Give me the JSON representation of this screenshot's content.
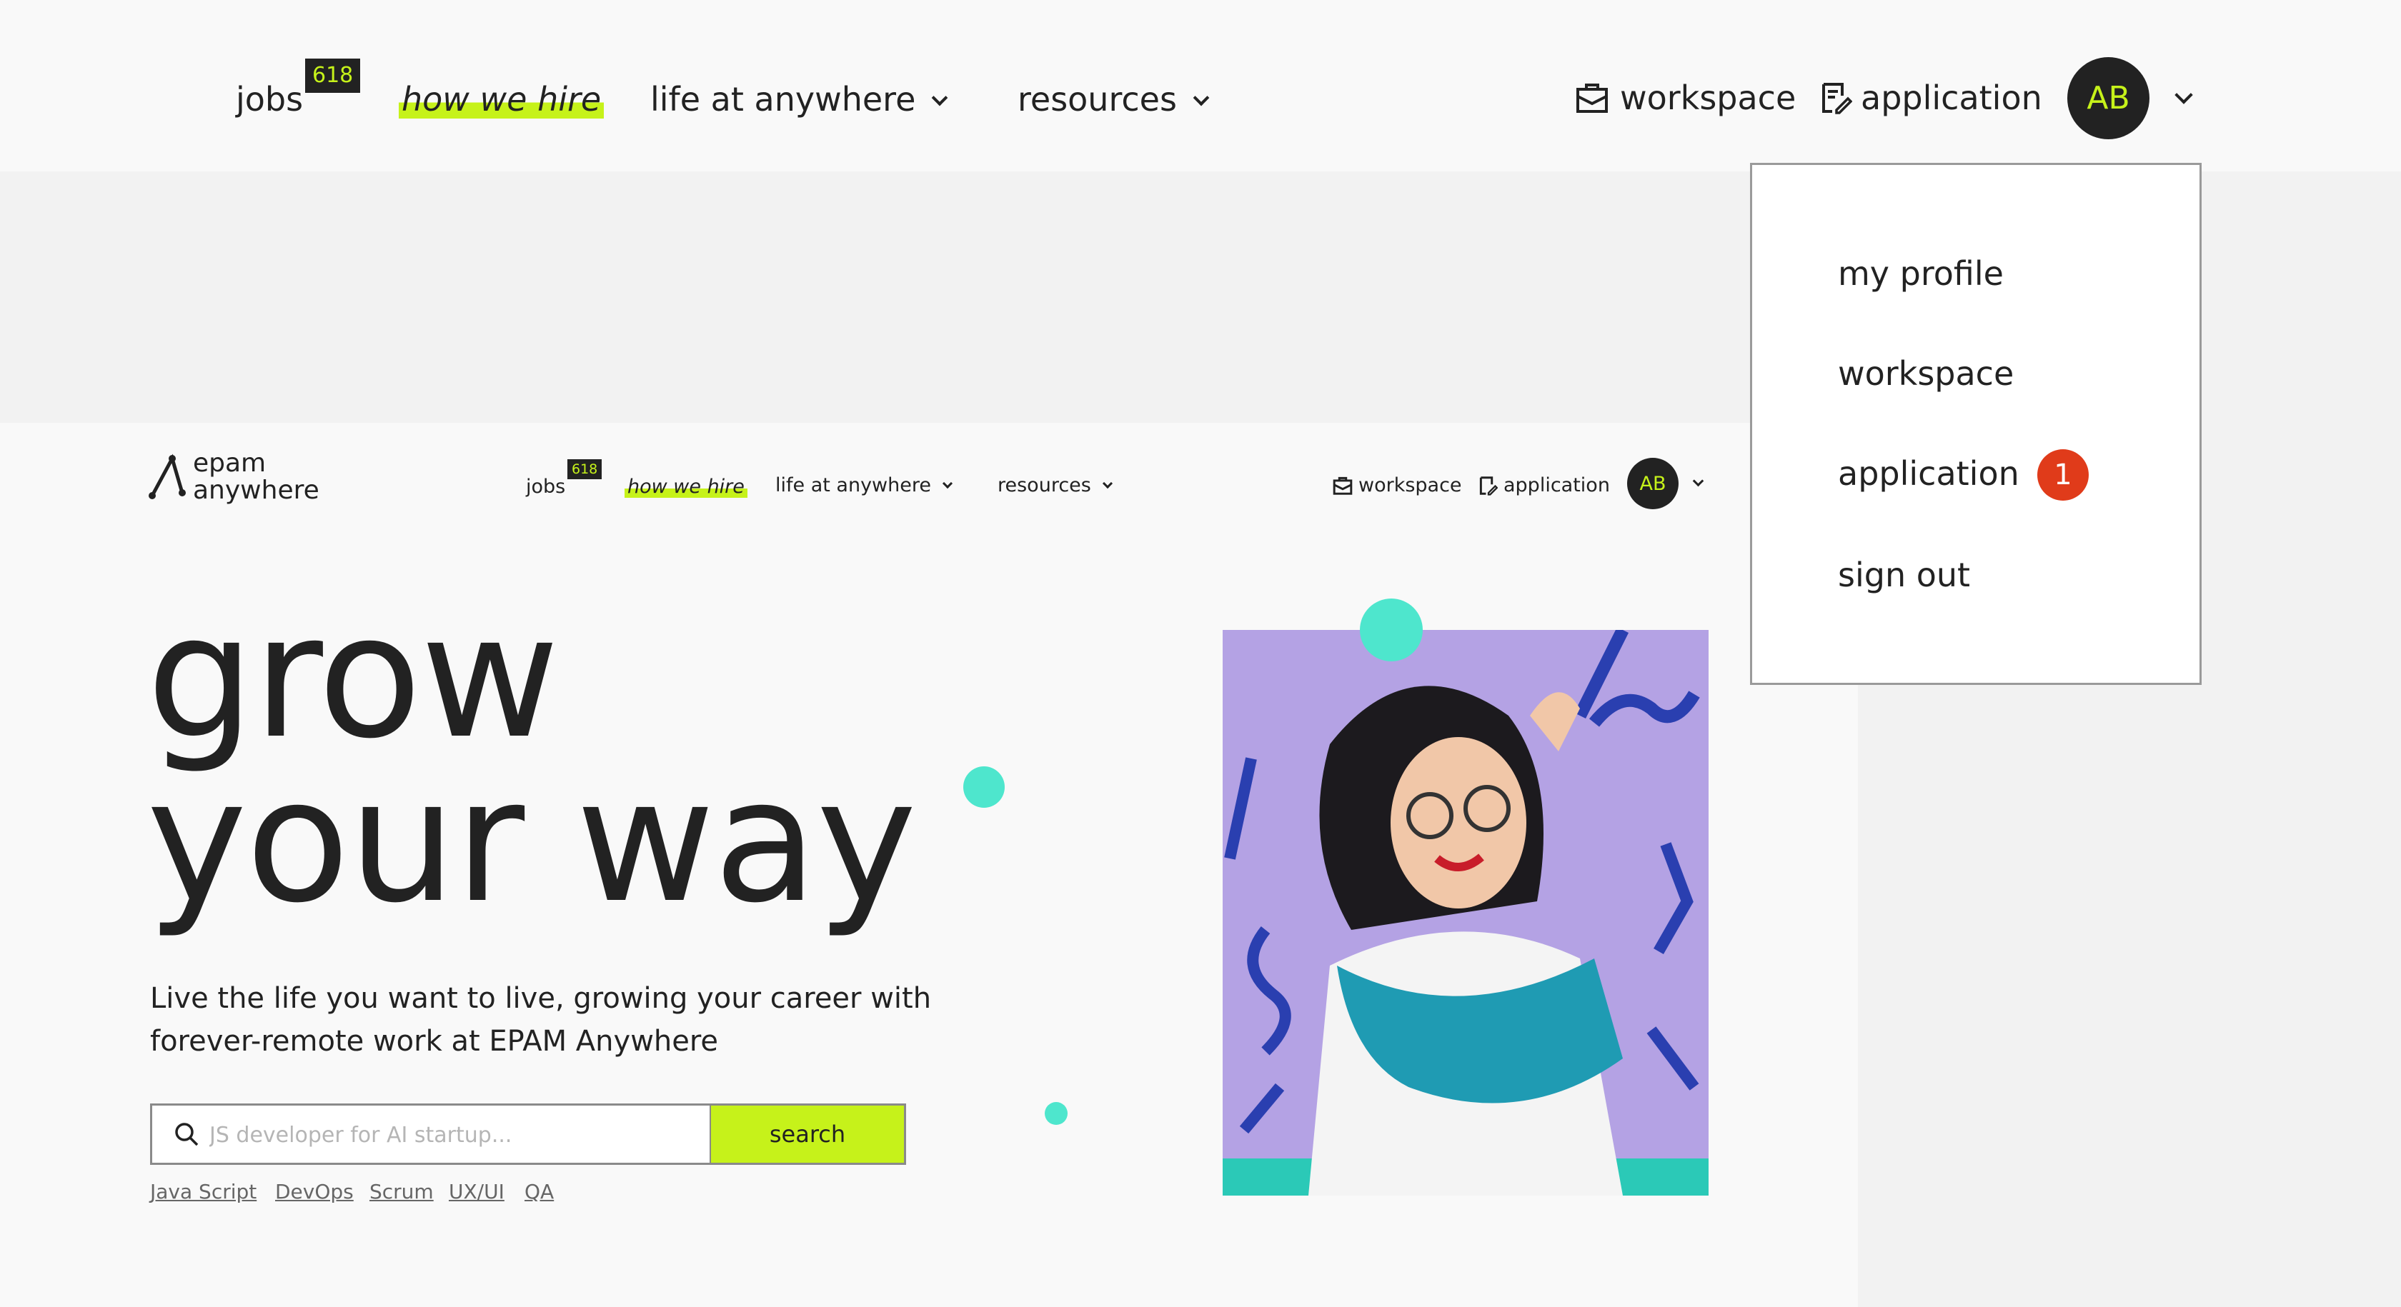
{
  "top_nav": {
    "jobs_label": "jobs",
    "jobs_count": "618",
    "how_we_hire_label": "how we hire",
    "life_label": "life at anywhere",
    "resources_label": "resources",
    "workspace_label": "workspace",
    "application_label": "application",
    "avatar_initials": "AB"
  },
  "account_menu": {
    "items": [
      "my profile",
      "workspace",
      "application",
      "sign out"
    ],
    "application_badge": "1"
  },
  "page_header": {
    "logo_line1": "epam",
    "logo_line2": "anywhere",
    "jobs_label": "jobs",
    "jobs_count": "618",
    "how_we_hire_label": "how we hire",
    "life_label": "life at anywhere",
    "resources_label": "resources",
    "workspace_label": "workspace",
    "application_label": "application",
    "avatar_initials": "AB"
  },
  "hero": {
    "title_line1": "grow",
    "title_line2": "your way",
    "subtitle": "Live the life you want to live, growing your career with forever-remote work at EPAM Anywhere",
    "search_placeholder": "JS developer for AI startup...",
    "search_button": "search",
    "tags": [
      "Java Script",
      "DevOps",
      "Scrum",
      "UX/UI",
      "QA"
    ]
  },
  "colors": {
    "accent_lime": "#c6f21a",
    "accent_teal": "#4ee6cd",
    "dark": "#222222",
    "notification_red": "#e03b1a"
  },
  "icons": [
    "workspace-briefcase-icon",
    "application-document-icon",
    "chevron-down-icon",
    "search-icon",
    "epam-logo-icon"
  ]
}
